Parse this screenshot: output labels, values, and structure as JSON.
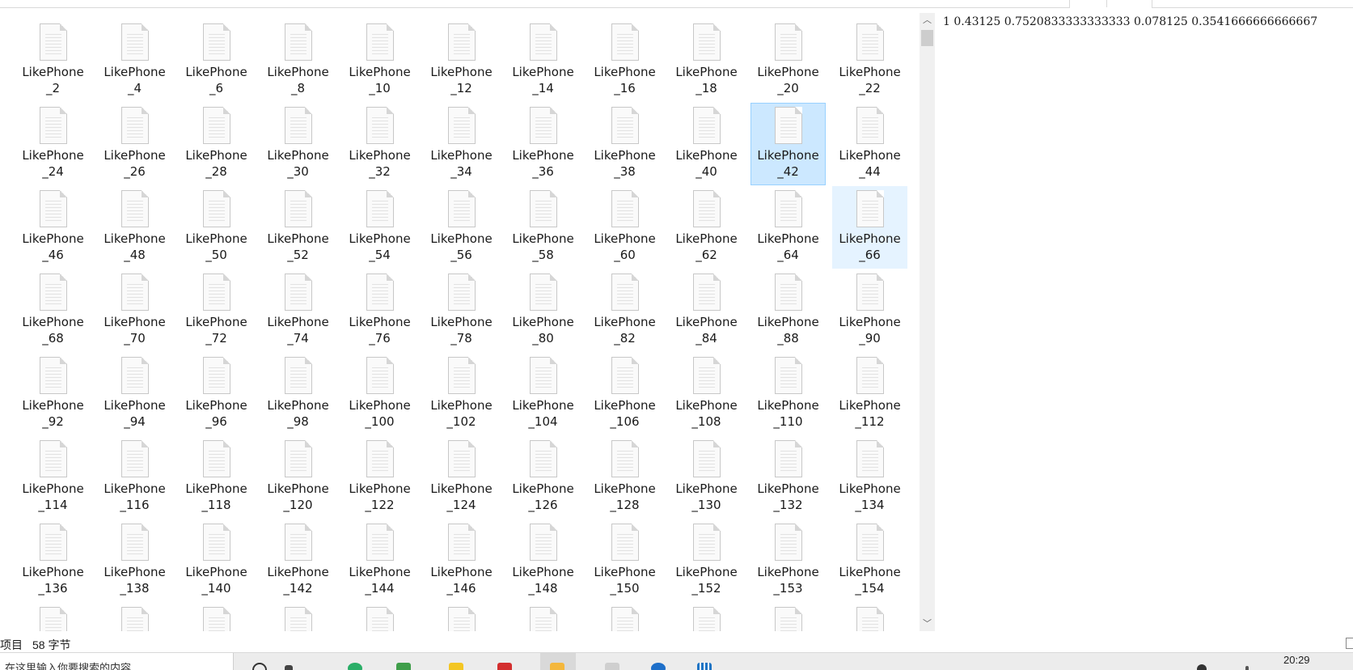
{
  "explorer": {
    "files": [
      {
        "line1": "LikePhone",
        "line2": "_2",
        "state": "normal"
      },
      {
        "line1": "LikePhone",
        "line2": "_4",
        "state": "normal"
      },
      {
        "line1": "LikePhone",
        "line2": "_6",
        "state": "normal"
      },
      {
        "line1": "LikePhone",
        "line2": "_8",
        "state": "normal"
      },
      {
        "line1": "LikePhone",
        "line2": "_10",
        "state": "normal"
      },
      {
        "line1": "LikePhone",
        "line2": "_12",
        "state": "normal"
      },
      {
        "line1": "LikePhone",
        "line2": "_14",
        "state": "normal"
      },
      {
        "line1": "LikePhone",
        "line2": "_16",
        "state": "normal"
      },
      {
        "line1": "LikePhone",
        "line2": "_18",
        "state": "normal"
      },
      {
        "line1": "LikePhone",
        "line2": "_20",
        "state": "normal"
      },
      {
        "line1": "LikePhone",
        "line2": "_22",
        "state": "normal"
      },
      {
        "line1": "LikePhone",
        "line2": "_24",
        "state": "normal"
      },
      {
        "line1": "LikePhone",
        "line2": "_26",
        "state": "normal"
      },
      {
        "line1": "LikePhone",
        "line2": "_28",
        "state": "normal"
      },
      {
        "line1": "LikePhone",
        "line2": "_30",
        "state": "normal"
      },
      {
        "line1": "LikePhone",
        "line2": "_32",
        "state": "normal"
      },
      {
        "line1": "LikePhone",
        "line2": "_34",
        "state": "normal"
      },
      {
        "line1": "LikePhone",
        "line2": "_36",
        "state": "normal"
      },
      {
        "line1": "LikePhone",
        "line2": "_38",
        "state": "normal"
      },
      {
        "line1": "LikePhone",
        "line2": "_40",
        "state": "normal"
      },
      {
        "line1": "LikePhone",
        "line2": "_42",
        "state": "selected"
      },
      {
        "line1": "LikePhone",
        "line2": "_44",
        "state": "normal"
      },
      {
        "line1": "LikePhone",
        "line2": "_46",
        "state": "normal"
      },
      {
        "line1": "LikePhone",
        "line2": "_48",
        "state": "normal"
      },
      {
        "line1": "LikePhone",
        "line2": "_50",
        "state": "normal"
      },
      {
        "line1": "LikePhone",
        "line2": "_52",
        "state": "normal"
      },
      {
        "line1": "LikePhone",
        "line2": "_54",
        "state": "normal"
      },
      {
        "line1": "LikePhone",
        "line2": "_56",
        "state": "normal"
      },
      {
        "line1": "LikePhone",
        "line2": "_58",
        "state": "normal"
      },
      {
        "line1": "LikePhone",
        "line2": "_60",
        "state": "normal"
      },
      {
        "line1": "LikePhone",
        "line2": "_62",
        "state": "normal"
      },
      {
        "line1": "LikePhone",
        "line2": "_64",
        "state": "normal"
      },
      {
        "line1": "LikePhone",
        "line2": "_66",
        "state": "hover"
      },
      {
        "line1": "LikePhone",
        "line2": "_68",
        "state": "normal"
      },
      {
        "line1": "LikePhone",
        "line2": "_70",
        "state": "normal"
      },
      {
        "line1": "LikePhone",
        "line2": "_72",
        "state": "normal"
      },
      {
        "line1": "LikePhone",
        "line2": "_74",
        "state": "normal"
      },
      {
        "line1": "LikePhone",
        "line2": "_76",
        "state": "normal"
      },
      {
        "line1": "LikePhone",
        "line2": "_78",
        "state": "normal"
      },
      {
        "line1": "LikePhone",
        "line2": "_80",
        "state": "normal"
      },
      {
        "line1": "LikePhone",
        "line2": "_82",
        "state": "normal"
      },
      {
        "line1": "LikePhone",
        "line2": "_84",
        "state": "normal"
      },
      {
        "line1": "LikePhone",
        "line2": "_88",
        "state": "normal"
      },
      {
        "line1": "LikePhone",
        "line2": "_90",
        "state": "normal"
      },
      {
        "line1": "LikePhone",
        "line2": "_92",
        "state": "normal"
      },
      {
        "line1": "LikePhone",
        "line2": "_94",
        "state": "normal"
      },
      {
        "line1": "LikePhone",
        "line2": "_96",
        "state": "normal"
      },
      {
        "line1": "LikePhone",
        "line2": "_98",
        "state": "normal"
      },
      {
        "line1": "LikePhone",
        "line2": "_100",
        "state": "normal"
      },
      {
        "line1": "LikePhone",
        "line2": "_102",
        "state": "normal"
      },
      {
        "line1": "LikePhone",
        "line2": "_104",
        "state": "normal"
      },
      {
        "line1": "LikePhone",
        "line2": "_106",
        "state": "normal"
      },
      {
        "line1": "LikePhone",
        "line2": "_108",
        "state": "normal"
      },
      {
        "line1": "LikePhone",
        "line2": "_110",
        "state": "normal"
      },
      {
        "line1": "LikePhone",
        "line2": "_112",
        "state": "normal"
      },
      {
        "line1": "LikePhone",
        "line2": "_114",
        "state": "normal"
      },
      {
        "line1": "LikePhone",
        "line2": "_116",
        "state": "normal"
      },
      {
        "line1": "LikePhone",
        "line2": "_118",
        "state": "normal"
      },
      {
        "line1": "LikePhone",
        "line2": "_120",
        "state": "normal"
      },
      {
        "line1": "LikePhone",
        "line2": "_122",
        "state": "normal"
      },
      {
        "line1": "LikePhone",
        "line2": "_124",
        "state": "normal"
      },
      {
        "line1": "LikePhone",
        "line2": "_126",
        "state": "normal"
      },
      {
        "line1": "LikePhone",
        "line2": "_128",
        "state": "normal"
      },
      {
        "line1": "LikePhone",
        "line2": "_130",
        "state": "normal"
      },
      {
        "line1": "LikePhone",
        "line2": "_132",
        "state": "normal"
      },
      {
        "line1": "LikePhone",
        "line2": "_134",
        "state": "normal"
      },
      {
        "line1": "LikePhone",
        "line2": "_136",
        "state": "normal"
      },
      {
        "line1": "LikePhone",
        "line2": "_138",
        "state": "normal"
      },
      {
        "line1": "LikePhone",
        "line2": "_140",
        "state": "normal"
      },
      {
        "line1": "LikePhone",
        "line2": "_142",
        "state": "normal"
      },
      {
        "line1": "LikePhone",
        "line2": "_144",
        "state": "normal"
      },
      {
        "line1": "LikePhone",
        "line2": "_146",
        "state": "normal"
      },
      {
        "line1": "LikePhone",
        "line2": "_148",
        "state": "normal"
      },
      {
        "line1": "LikePhone",
        "line2": "_150",
        "state": "normal"
      },
      {
        "line1": "LikePhone",
        "line2": "_152",
        "state": "normal"
      },
      {
        "line1": "LikePhone",
        "line2": "_153",
        "state": "normal"
      },
      {
        "line1": "LikePhone",
        "line2": "_154",
        "state": "normal"
      },
      {
        "line1": "",
        "line2": "",
        "state": "normal"
      },
      {
        "line1": "",
        "line2": "",
        "state": "normal"
      },
      {
        "line1": "",
        "line2": "",
        "state": "normal"
      },
      {
        "line1": "",
        "line2": "",
        "state": "normal"
      },
      {
        "line1": "",
        "line2": "",
        "state": "normal"
      },
      {
        "line1": "",
        "line2": "",
        "state": "normal"
      },
      {
        "line1": "",
        "line2": "",
        "state": "normal"
      },
      {
        "line1": "",
        "line2": "",
        "state": "normal"
      },
      {
        "line1": "",
        "line2": "",
        "state": "normal"
      },
      {
        "line1": "",
        "line2": "",
        "state": "normal"
      },
      {
        "line1": "",
        "line2": "",
        "state": "normal"
      }
    ]
  },
  "preview": {
    "text": "1 0.43125 0.7520833333333333 0.078125 0.3541666666666667"
  },
  "status_bar": {
    "items_label": "项目",
    "size_label": "58 字节"
  },
  "taskbar": {
    "search_text": "在这里输入你要搜索的内容",
    "clock": "20:29"
  },
  "colors": {
    "selected_bg": "#cce8ff",
    "selected_border": "#99d1ff",
    "hover_bg": "#e5f3ff"
  }
}
